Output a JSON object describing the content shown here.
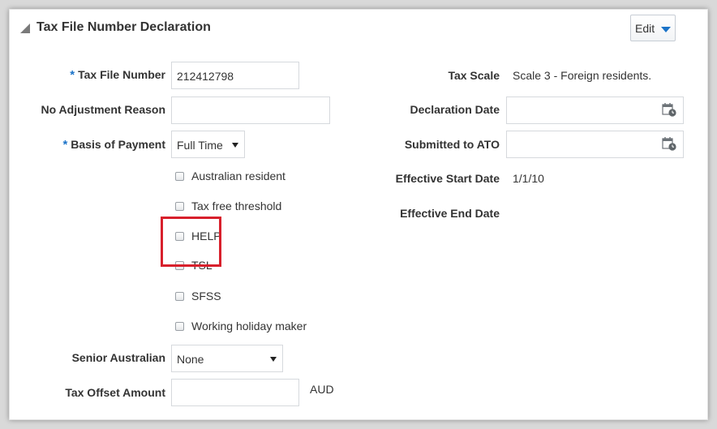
{
  "section": {
    "title": "Tax File Number Declaration",
    "edit_label": "Edit"
  },
  "left_fields": {
    "tax_file_number": {
      "label": "Tax File Number",
      "value": "212412798"
    },
    "no_adjustment_reason": {
      "label": "No Adjustment Reason",
      "value": ""
    },
    "basis_of_payment": {
      "label": "Basis of Payment",
      "value": "Full Time"
    },
    "senior_australian": {
      "label": "Senior Australian",
      "value": "None"
    },
    "tax_offset_amount": {
      "label": "Tax Offset Amount",
      "value": "",
      "currency": "AUD"
    }
  },
  "checkboxes": [
    {
      "label": "Australian resident",
      "checked": false
    },
    {
      "label": "Tax free threshold",
      "checked": false
    },
    {
      "label": "HELP",
      "checked": false
    },
    {
      "label": "TSL",
      "checked": false
    },
    {
      "label": "SFSS",
      "checked": false
    },
    {
      "label": "Working holiday maker",
      "checked": false
    }
  ],
  "right_fields": {
    "tax_scale": {
      "label": "Tax Scale",
      "value": "Scale 3 - Foreign residents."
    },
    "declaration_date": {
      "label": "Declaration Date",
      "value": ""
    },
    "submitted_to_ato": {
      "label": "Submitted to ATO",
      "value": ""
    },
    "effective_start_date": {
      "label": "Effective Start Date",
      "value": "1/1/10"
    },
    "effective_end_date": {
      "label": "Effective End Date",
      "value": ""
    }
  },
  "required_marker": "*",
  "colors": {
    "accent": "#1b73c8",
    "highlight": "#d8202c",
    "text": "#333333"
  },
  "icons": {
    "collapse": "triangle-collapse-icon",
    "dropdown": "caret-down-icon",
    "calendar": "calendar-icon"
  }
}
